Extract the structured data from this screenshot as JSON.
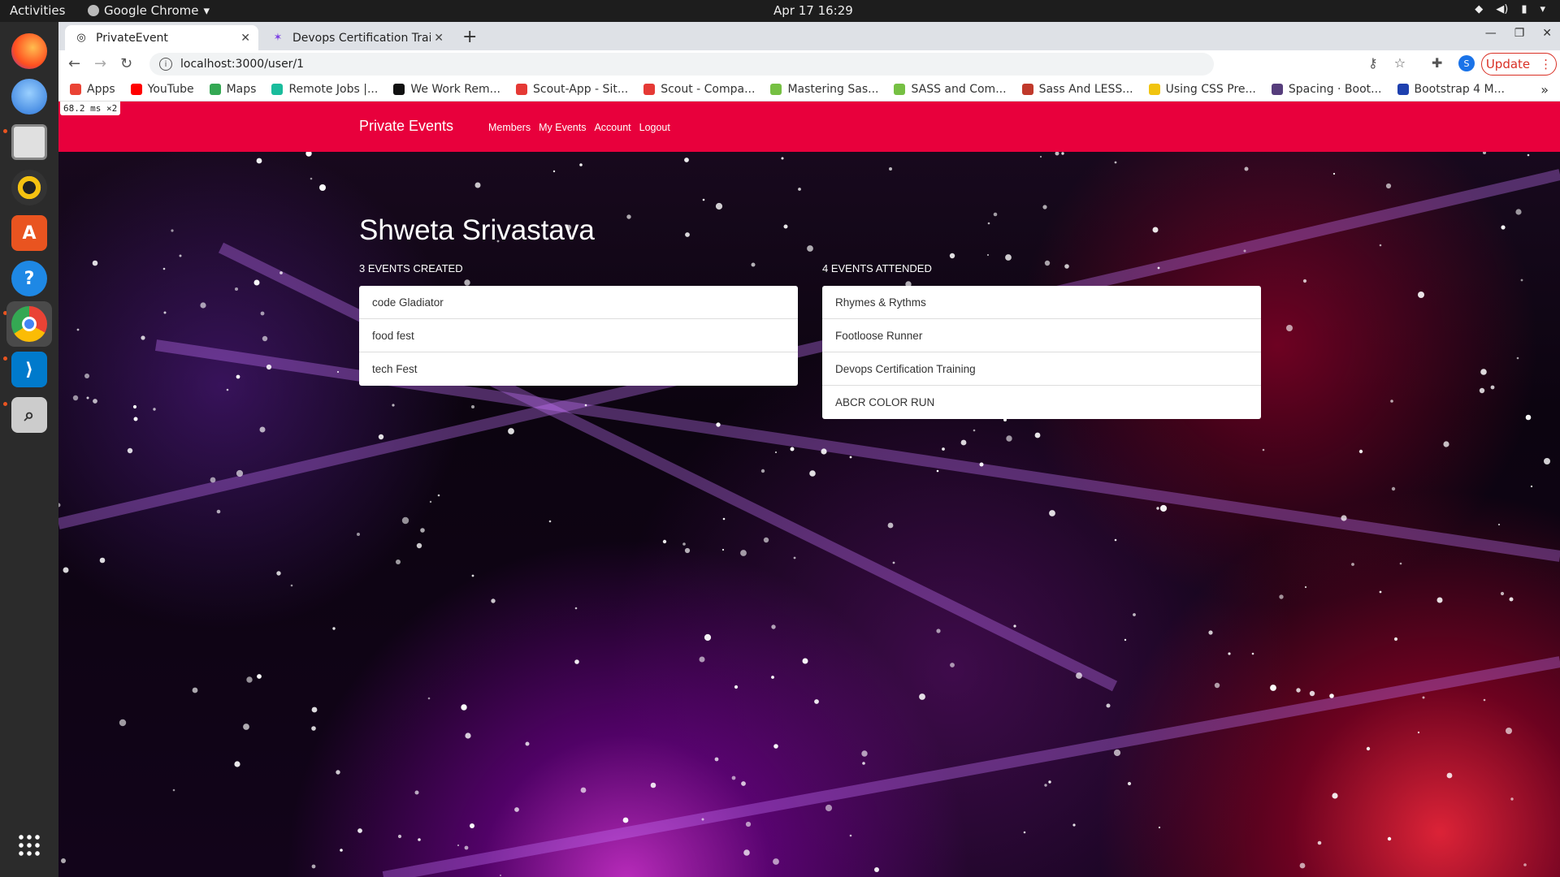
{
  "system": {
    "activities": "Activities",
    "app_name": "Google Chrome",
    "clock": "Apr 17  16:29"
  },
  "tabs": [
    {
      "title": "PrivateEvent"
    },
    {
      "title": "Devops Certification Trai"
    }
  ],
  "toolbar": {
    "url": "localhost:3000/user/1",
    "update_label": "Update",
    "profile_initial": "S"
  },
  "bookmarks": [
    {
      "label": "Apps",
      "color": "#ea4335"
    },
    {
      "label": "YouTube",
      "color": "#ff0000"
    },
    {
      "label": "Maps",
      "color": "#34a853"
    },
    {
      "label": "Remote Jobs |...",
      "color": "#1abc9c"
    },
    {
      "label": "We Work Rem...",
      "color": "#111111"
    },
    {
      "label": "Scout-App - Sit...",
      "color": "#e53935"
    },
    {
      "label": "Scout - Compa...",
      "color": "#e53935"
    },
    {
      "label": "Mastering Sas...",
      "color": "#76c043"
    },
    {
      "label": "SASS and Com...",
      "color": "#76c043"
    },
    {
      "label": "Sass And LESS...",
      "color": "#c0392b"
    },
    {
      "label": "Using CSS Pre...",
      "color": "#f1c40f"
    },
    {
      "label": "Spacing · Boot...",
      "color": "#563d7c"
    },
    {
      "label": "Bootstrap 4 M...",
      "color": "#1e40af"
    }
  ],
  "perf_badge": "68.2 ms ×2",
  "site": {
    "brand": "Private Events",
    "nav": [
      "Members",
      "My Events",
      "Account",
      "Logout"
    ],
    "user_name": "Shweta Srivastava",
    "created_title": "3 EVENTS CREATED",
    "created": [
      "code Gladiator",
      "food fest",
      "tech Fest"
    ],
    "attended_title": "4 EVENTS ATTENDED",
    "attended": [
      "Rhymes & Rythms",
      "Footloose Runner",
      "Devops Certification Training",
      "ABCR COLOR RUN"
    ],
    "navbar_color": "#e8003c"
  }
}
